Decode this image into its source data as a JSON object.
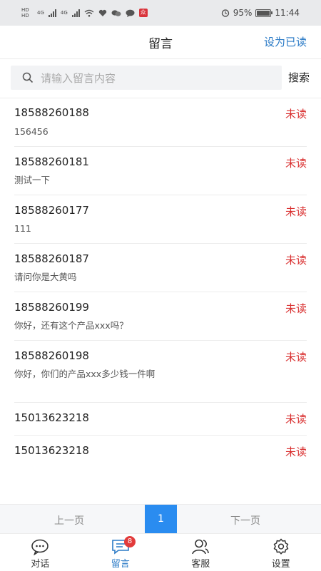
{
  "status_bar": {
    "sim1": "HD",
    "sim2": "HD",
    "network1": "4G",
    "network2": "4G",
    "battery_percent": "95%",
    "battery_level": 0.95,
    "time": "11:44",
    "icons": [
      "wifi-icon",
      "heart-icon",
      "chat-bubbles-icon",
      "message-icon",
      "app-badge-icon",
      "alarm-icon",
      "battery-icon"
    ]
  },
  "header": {
    "title": "留言",
    "mark_read_label": "设为已读"
  },
  "search": {
    "placeholder": "请输入留言内容",
    "button_label": "搜索"
  },
  "messages": [
    {
      "phone": "18588260188",
      "status": "未读",
      "content": "156456"
    },
    {
      "phone": "18588260181",
      "status": "未读",
      "content": "测试一下"
    },
    {
      "phone": "18588260177",
      "status": "未读",
      "content": "111"
    },
    {
      "phone": "18588260187",
      "status": "未读",
      "content": "请问你是大黄吗"
    },
    {
      "phone": "18588260199",
      "status": "未读",
      "content": "你好，还有这个产品xxx吗？"
    },
    {
      "phone": "18588260198",
      "status": "未读",
      "content": "你好，你们的产品xxx多少钱一件啊"
    },
    {
      "phone": "15013623218",
      "status": "未读",
      "content": ""
    },
    {
      "phone": "15013623218",
      "status": "未读",
      "content": ""
    }
  ],
  "pagination": {
    "prev_label": "上一页",
    "current": "1",
    "next_label": "下一页"
  },
  "bottom_nav": {
    "items": [
      {
        "label": "对话",
        "icon": "chat-icon",
        "active": false
      },
      {
        "label": "留言",
        "icon": "message-board-icon",
        "active": true,
        "badge": "8"
      },
      {
        "label": "客服",
        "icon": "customer-service-icon",
        "active": false
      },
      {
        "label": "设置",
        "icon": "settings-icon",
        "active": false
      }
    ]
  },
  "colors": {
    "accent": "#2a7ac6",
    "unread": "#d93030",
    "page_active": "#2a8cf0",
    "badge": "#e23b3b"
  }
}
